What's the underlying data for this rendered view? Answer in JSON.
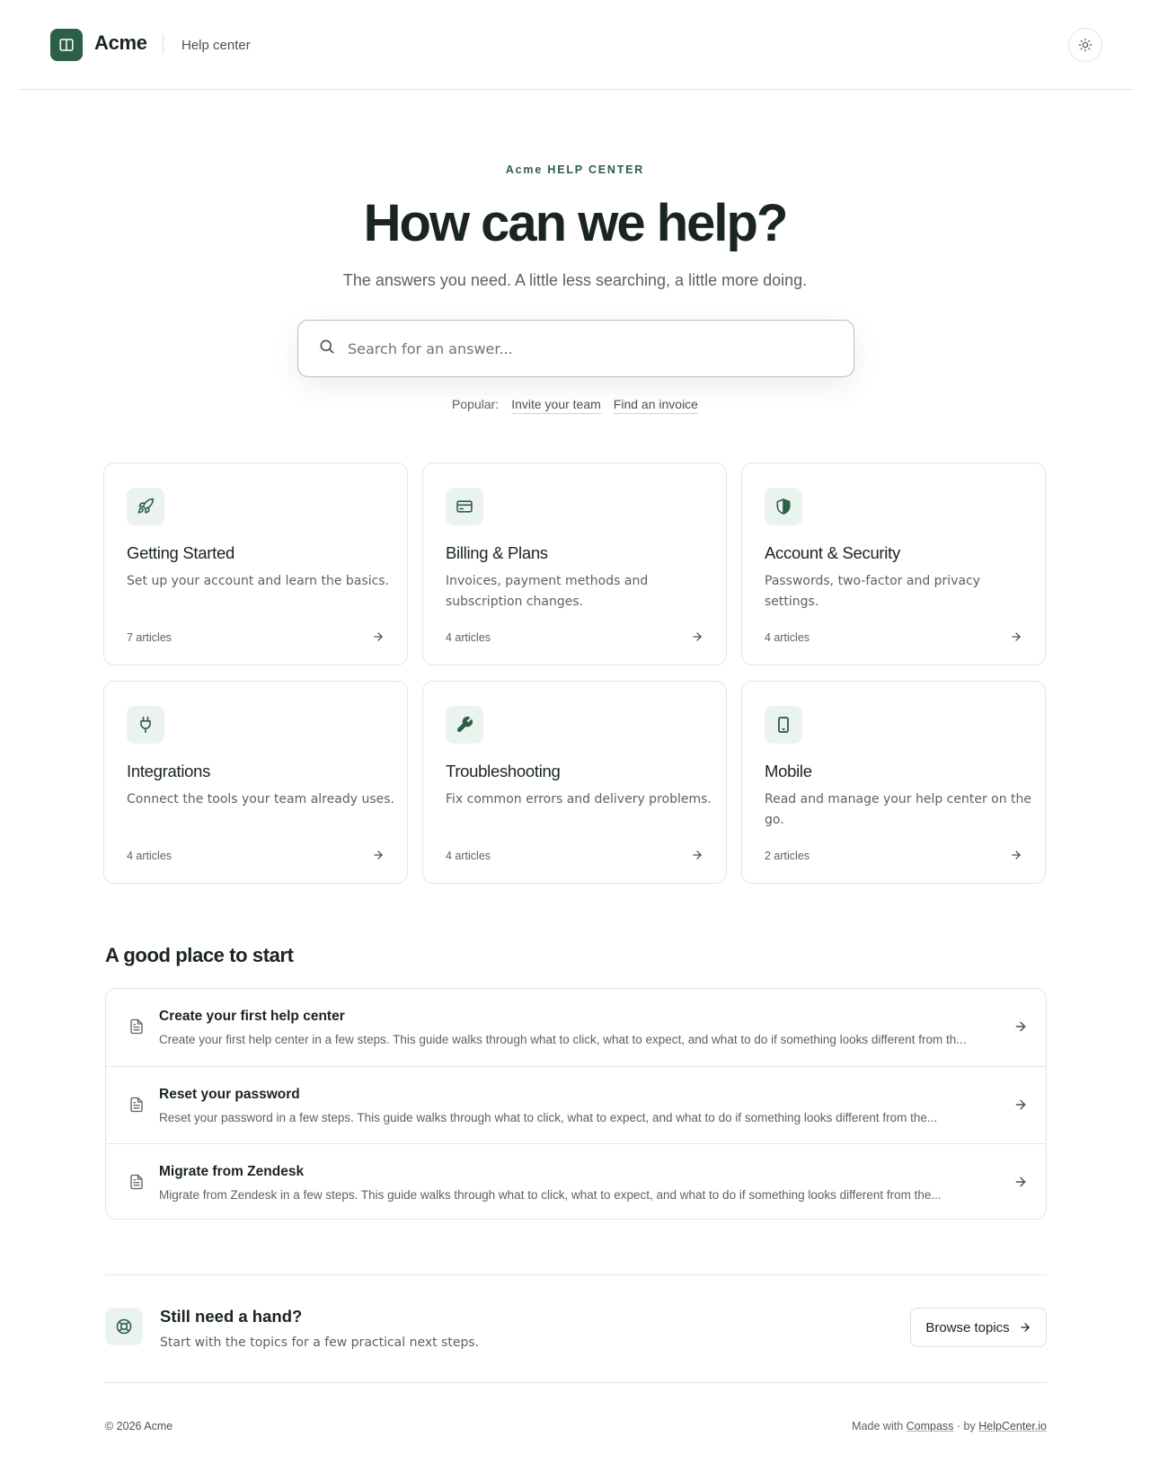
{
  "header": {
    "brand": "Acme",
    "nav_label": "Help center",
    "logo_icon": "book-open-icon",
    "theme_icon": "sun-icon"
  },
  "hero": {
    "eyebrow": "Acme HELP CENTER",
    "title": "How can we help?",
    "subtitle": "The answers you need. A little less searching, a little more doing.",
    "search_placeholder": "Search for an answer...",
    "search_value": "",
    "popular_label": "Popular:",
    "popular_links": [
      "Invite your team",
      "Find an invoice"
    ]
  },
  "categories": [
    {
      "icon": "rocket-icon",
      "title": "Getting Started",
      "description": "Set up your account and learn the basics.",
      "count": "7 articles"
    },
    {
      "icon": "credit-card-icon",
      "title": "Billing & Plans",
      "description": "Invoices, payment methods and subscription changes.",
      "count": "4 articles"
    },
    {
      "icon": "shield-icon",
      "title": "Account & Security",
      "description": "Passwords, two-factor and privacy settings.",
      "count": "4 articles"
    },
    {
      "icon": "plug-icon",
      "title": "Integrations",
      "description": "Connect the tools your team already uses.",
      "count": "4 articles"
    },
    {
      "icon": "wrench-icon",
      "title": "Troubleshooting",
      "description": "Fix common errors and delivery problems.",
      "count": "4 articles"
    },
    {
      "icon": "smartphone-icon",
      "title": "Mobile",
      "description": "Read and manage your help center on the go.",
      "count": "2 articles"
    }
  ],
  "start_section": {
    "title": "A good place to start",
    "articles": [
      {
        "title": "Create your first help center",
        "description": "Create your first help center in a few steps. This guide walks through what to click, what to expect, and what to do if something looks different from th..."
      },
      {
        "title": "Reset your password",
        "description": "Reset your password in a few steps. This guide walks through what to click, what to expect, and what to do if something looks different from the..."
      },
      {
        "title": "Migrate from Zendesk",
        "description": "Migrate from Zendesk in a few steps. This guide walks through what to click, what to expect, and what to do if something looks different from the..."
      }
    ]
  },
  "help_band": {
    "icon": "life-buoy-icon",
    "title": "Still need a hand?",
    "subtitle": "Start with the topics for a few practical next steps.",
    "button_label": "Browse topics"
  },
  "footer": {
    "copyright": "© 2026 Acme",
    "made_with": "Made with",
    "compass_link": "Compass",
    "by": "· by",
    "helpcenter_link": "HelpCenter.io"
  },
  "colors": {
    "accent": "#2c5e48",
    "icon_bg": "#eaf3ee",
    "text": "#1a2421",
    "muted": "#5b6360",
    "border": "#e3e6e4"
  }
}
